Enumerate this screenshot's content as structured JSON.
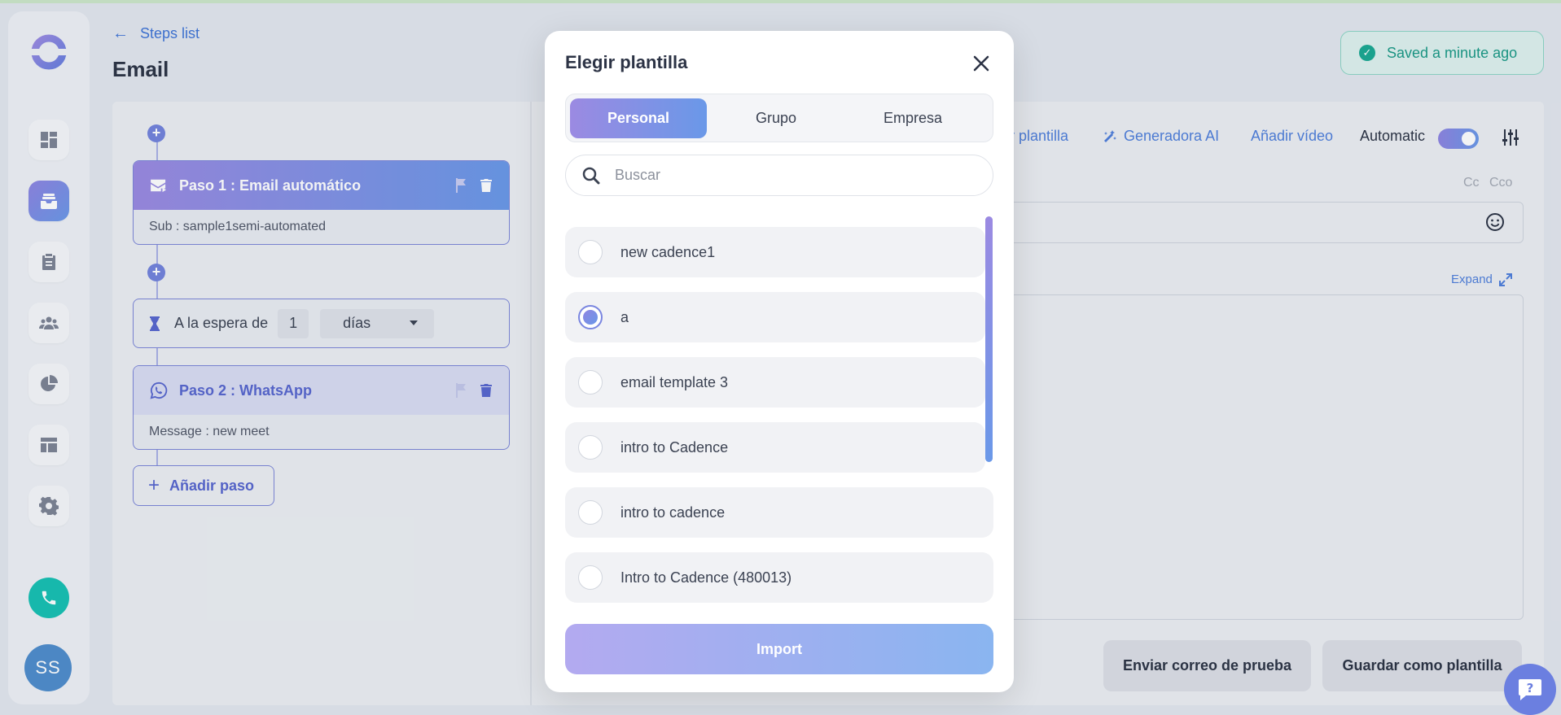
{
  "header": {
    "back_label": "Steps list",
    "title": "Email",
    "saved_status": "Saved a minute ago"
  },
  "steps": {
    "step1_title": "Paso 1 : Email automático",
    "step1_sub": "Sub : sample1semi-automated",
    "wait_prefix": "A la espera de",
    "wait_value": "1",
    "wait_unit": "días",
    "step2_title": "Paso 2 : WhatsApp",
    "step2_sub": "Message : new meet",
    "add_step_label": "Añadir paso"
  },
  "editor": {
    "toolbar_template_fragment": "r plantilla",
    "toolbar_ai": "Generadora AI",
    "toolbar_video": "Añadir vídeo",
    "toolbar_mode": "Automatic",
    "cc": "Cc",
    "cco": "Cco",
    "expand_label": "Expand",
    "send_test_label": "Enviar correo de prueba",
    "save_template_label": "Guardar como plantilla"
  },
  "modal": {
    "title": "Elegir plantilla",
    "tabs": [
      "Personal",
      "Grupo",
      "Empresa"
    ],
    "active_tab": "Personal",
    "search_placeholder": "Buscar",
    "templates": [
      {
        "name": "new cadence1",
        "selected": false
      },
      {
        "name": "a",
        "selected": true
      },
      {
        "name": "email template 3",
        "selected": false
      },
      {
        "name": "intro to Cadence",
        "selected": false
      },
      {
        "name": "intro to cadence",
        "selected": false
      },
      {
        "name": "Intro to Cadence (480013)",
        "selected": false
      }
    ],
    "import_label": "Import"
  },
  "user": {
    "initials": "SS"
  },
  "colors": {
    "accent_start": "#9b8ae2",
    "accent_end": "#6a98e8",
    "link": "#4f7fdb",
    "success": "#1a9a86",
    "call": "#17c1b3"
  }
}
